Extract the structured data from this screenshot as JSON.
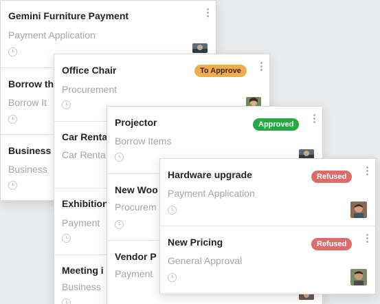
{
  "colors": {
    "to_approve": "#f0ad4e",
    "approved": "#28a745",
    "refused": "#e06b6b"
  },
  "panel1": {
    "cards": [
      {
        "title": "Gemini Furniture Payment",
        "subtitle": "Payment Application"
      },
      {
        "title": "Borrow th",
        "subtitle": "Borrow It"
      },
      {
        "title": "Business",
        "subtitle": "Business"
      }
    ]
  },
  "panel2": {
    "cards": [
      {
        "title": "Office Chair",
        "subtitle": "Procurement",
        "status": "To Approve"
      },
      {
        "title": "Car Renta",
        "subtitle": "Car Renta"
      },
      {
        "title": "Exhibition",
        "subtitle": "Payment"
      },
      {
        "title": "Meeting i",
        "subtitle": "Business"
      }
    ]
  },
  "panel3": {
    "cards": [
      {
        "title": "Projector",
        "subtitle": "Borrow Items",
        "status": "Approved"
      },
      {
        "title": "New Woo",
        "subtitle": "Procurem"
      },
      {
        "title": "Vendor P",
        "subtitle": "Payment"
      }
    ]
  },
  "panel4": {
    "cards": [
      {
        "title": "Hardware upgrade",
        "subtitle": "Payment Application",
        "status": "Refused"
      },
      {
        "title": "New Pricing",
        "subtitle": "General Approval",
        "status": "Refused"
      }
    ]
  }
}
